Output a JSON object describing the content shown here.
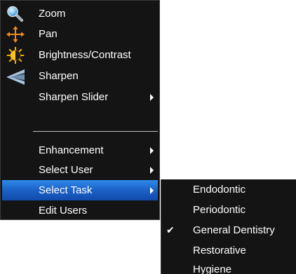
{
  "context_menu": {
    "items": [
      {
        "label": "Zoom",
        "icon": "magnifier-icon"
      },
      {
        "label": "Pan",
        "icon": "move-arrows-icon"
      },
      {
        "label": "Brightness/Contrast",
        "icon": "sun-contrast-icon"
      },
      {
        "label": "Sharpen",
        "icon": "sharpen-icon"
      },
      {
        "label": "Sharpen Slider",
        "has_submenu": true
      },
      {
        "label": "Enhancement",
        "has_submenu": true
      },
      {
        "label": "Select User",
        "has_submenu": true
      },
      {
        "label": "Select Task",
        "has_submenu": true,
        "highlighted": true
      },
      {
        "label": "Edit Users"
      }
    ]
  },
  "task_submenu": {
    "items": [
      {
        "label": "Endodontic",
        "checked": false
      },
      {
        "label": "Periodontic",
        "checked": false
      },
      {
        "label": "General Dentistry",
        "checked": true
      },
      {
        "label": "Restorative",
        "checked": false
      },
      {
        "label": "Hygiene",
        "checked": false
      }
    ],
    "check_glyph": "✔"
  },
  "colors": {
    "menu_background": "#141414",
    "highlight": "#1d63c9",
    "text": "#ffffff"
  }
}
